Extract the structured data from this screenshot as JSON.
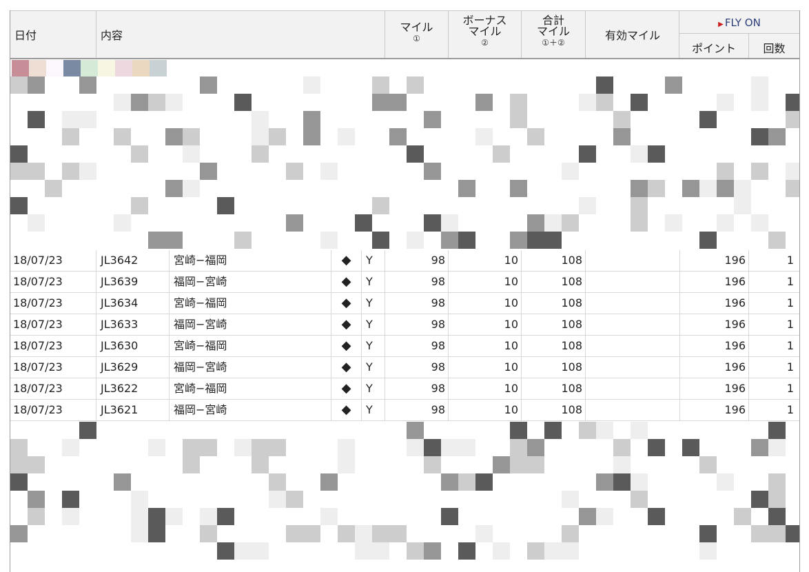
{
  "header": {
    "date": "日付",
    "content": "内容",
    "miles_l1": "マイル",
    "miles_l2": "①",
    "bonus_l1": "ボーナス",
    "bonus_l2": "マイル",
    "bonus_l3": "②",
    "total_l1": "合計",
    "total_l2": "マイル",
    "total_l3": "①＋②",
    "effective": "有効マイル",
    "flyon": "FLY ON",
    "points": "ポイント",
    "count": "回数"
  },
  "swatch_colors": [
    "#c88e98",
    "#efded4",
    "#fbf7fd",
    "#7b8aa3",
    "#d6ead8",
    "#f6f6e2",
    "#ecd8de",
    "#ead8c0",
    "#c8d2d4"
  ],
  "rows": [
    {
      "date": "18/07/23",
      "flight": "JL3642",
      "route": "宮崎−福岡",
      "mark": "◆",
      "cls": "Y",
      "miles": "98",
      "bonus": "10",
      "total": "108",
      "points": "196",
      "count": "1"
    },
    {
      "date": "18/07/23",
      "flight": "JL3639",
      "route": "福岡−宮崎",
      "mark": "◆",
      "cls": "Y",
      "miles": "98",
      "bonus": "10",
      "total": "108",
      "points": "196",
      "count": "1"
    },
    {
      "date": "18/07/23",
      "flight": "JL3634",
      "route": "宮崎−福岡",
      "mark": "◆",
      "cls": "Y",
      "miles": "98",
      "bonus": "10",
      "total": "108",
      "points": "196",
      "count": "1"
    },
    {
      "date": "18/07/23",
      "flight": "JL3633",
      "route": "福岡−宮崎",
      "mark": "◆",
      "cls": "Y",
      "miles": "98",
      "bonus": "10",
      "total": "108",
      "points": "196",
      "count": "1"
    },
    {
      "date": "18/07/23",
      "flight": "JL3630",
      "route": "宮崎−福岡",
      "mark": "◆",
      "cls": "Y",
      "miles": "98",
      "bonus": "10",
      "total": "108",
      "points": "196",
      "count": "1"
    },
    {
      "date": "18/07/23",
      "flight": "JL3629",
      "route": "福岡−宮崎",
      "mark": "◆",
      "cls": "Y",
      "miles": "98",
      "bonus": "10",
      "total": "108",
      "points": "196",
      "count": "1"
    },
    {
      "date": "18/07/23",
      "flight": "JL3622",
      "route": "宮崎−福岡",
      "mark": "◆",
      "cls": "Y",
      "miles": "98",
      "bonus": "10",
      "total": "108",
      "points": "196",
      "count": "1"
    },
    {
      "date": "18/07/23",
      "flight": "JL3621",
      "route": "福岡−宮崎",
      "mark": "◆",
      "cls": "Y",
      "miles": "98",
      "bonus": "10",
      "total": "108",
      "points": "196",
      "count": "1"
    }
  ]
}
